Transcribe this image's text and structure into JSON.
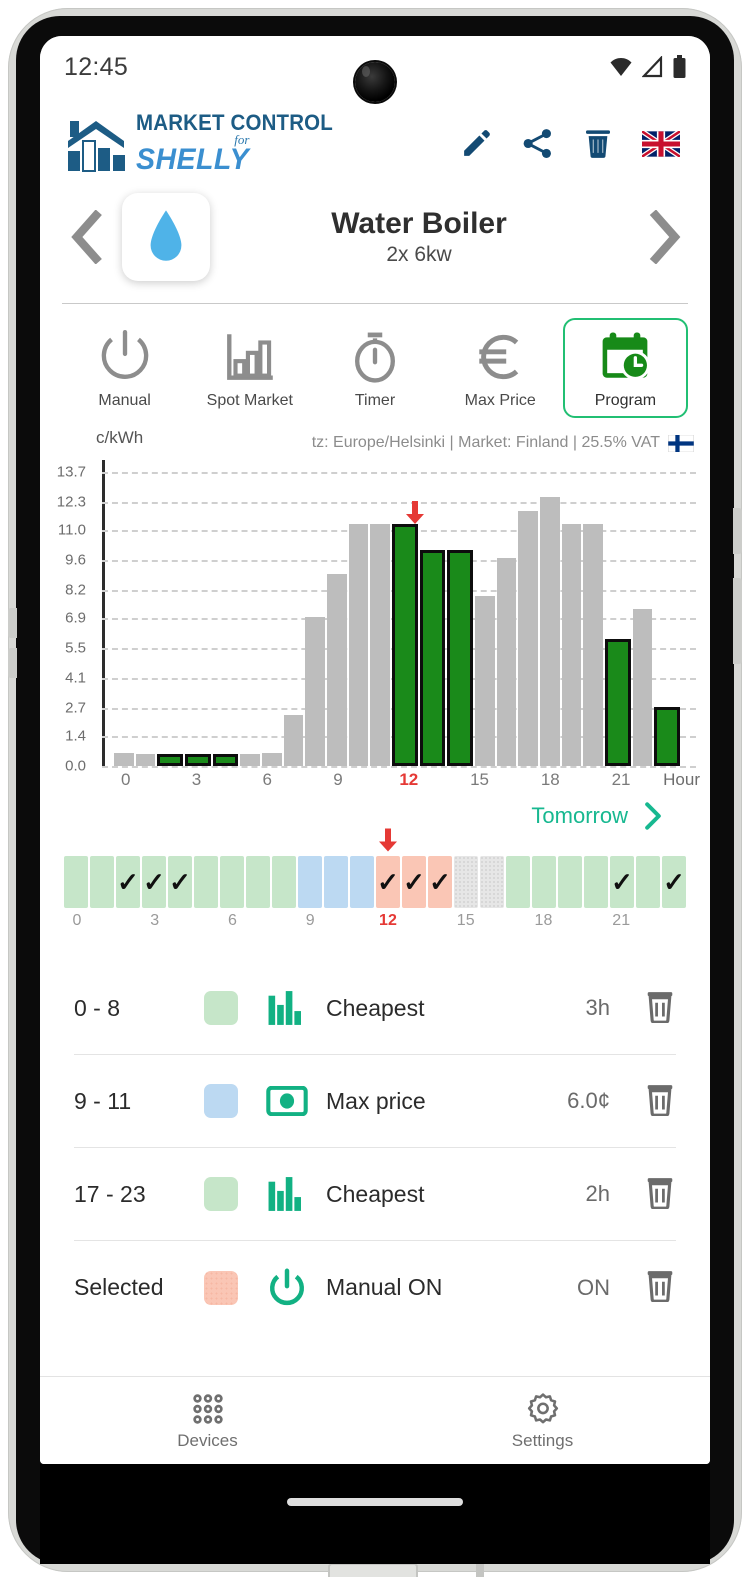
{
  "status": {
    "time": "12:45",
    "icons": [
      "wifi-icon",
      "cellular-icon",
      "battery-icon"
    ]
  },
  "app_bar": {
    "logo": {
      "line1": "MARKET CONTROL",
      "line2": "for",
      "line3": "SHELLY"
    },
    "actions": [
      {
        "name": "edit-icon",
        "label": "Edit"
      },
      {
        "name": "share-icon",
        "label": "Share"
      },
      {
        "name": "delete-icon",
        "label": "Delete"
      },
      {
        "name": "language-flag-icon",
        "label": "English (UK)"
      }
    ]
  },
  "device": {
    "prev_label": "Previous device",
    "next_label": "Next device",
    "icon": "water-drop-icon",
    "name": "Water Boiler",
    "subtitle": "2x 6kw"
  },
  "modes": [
    {
      "id": "manual",
      "label": "Manual",
      "icon": "power-icon",
      "active": false
    },
    {
      "id": "spotmarket",
      "label": "Spot Market",
      "icon": "bar-chart-icon",
      "active": false
    },
    {
      "id": "timer",
      "label": "Timer",
      "icon": "stopwatch-icon",
      "active": false
    },
    {
      "id": "maxprice",
      "label": "Max Price",
      "icon": "euro-icon",
      "active": false
    },
    {
      "id": "program",
      "label": "Program",
      "icon": "calendar-clock-icon",
      "active": true
    }
  ],
  "chart_meta": {
    "unit": "c/kWh",
    "info": "tz: Europe/Helsinki | Market: Finland | 25.5% VAT",
    "flag": "finland-flag-icon",
    "hour_axis_label": "Hour",
    "tomorrow_label": "Tomorrow",
    "tomorrow_icon": "chevron-right-icon"
  },
  "chart_data": {
    "type": "bar",
    "title": "",
    "xlabel": "Hour",
    "ylabel": "c/kWh",
    "ylim": [
      0.0,
      13.7
    ],
    "grid": true,
    "yticks": [
      "0.0",
      "1.4",
      "2.7",
      "4.1",
      "5.5",
      "6.9",
      "8.2",
      "9.6",
      "11.0",
      "12.3",
      "13.7"
    ],
    "ytick_values": [
      0.0,
      1.4,
      2.7,
      4.1,
      5.5,
      6.9,
      8.2,
      9.6,
      11.0,
      12.3,
      13.7
    ],
    "xticks": [
      "0",
      "3",
      "6",
      "9",
      "12",
      "15",
      "18",
      "21"
    ],
    "xtick_values": [
      0,
      3,
      6,
      9,
      12,
      15,
      18,
      21
    ],
    "current_hour": 12,
    "categories": [
      0,
      1,
      2,
      3,
      4,
      5,
      6,
      7,
      8,
      9,
      10,
      11,
      12,
      13,
      14,
      15,
      16,
      17,
      18,
      19,
      20,
      21,
      22,
      23
    ],
    "values": [
      0.6,
      0.55,
      0.55,
      0.55,
      0.55,
      0.55,
      0.6,
      2.4,
      6.95,
      8.95,
      11.3,
      11.3,
      11.3,
      10.05,
      10.05,
      7.9,
      9.7,
      11.9,
      12.55,
      11.3,
      11.3,
      5.9,
      7.3,
      2.75
    ],
    "selected": [
      false,
      false,
      true,
      true,
      true,
      false,
      false,
      false,
      false,
      false,
      false,
      false,
      true,
      true,
      true,
      false,
      false,
      false,
      false,
      false,
      false,
      true,
      false,
      true
    ],
    "bar_color": "#bdbdbd",
    "selected_color": "#1a8a1a",
    "selected_outline": "#0d0d0d",
    "now_marker_hour": 12,
    "now_marker_color": "#e53935"
  },
  "hour_strip": {
    "labels": [
      "0",
      "3",
      "6",
      "9",
      "12",
      "15",
      "18",
      "21"
    ],
    "label_values": [
      0,
      3,
      6,
      9,
      12,
      15,
      18,
      21
    ],
    "current_hour": 12,
    "cells": [
      {
        "hour": 0,
        "color": "green",
        "checked": false
      },
      {
        "hour": 1,
        "color": "green",
        "checked": false
      },
      {
        "hour": 2,
        "color": "green",
        "checked": true
      },
      {
        "hour": 3,
        "color": "green",
        "checked": true
      },
      {
        "hour": 4,
        "color": "green",
        "checked": true
      },
      {
        "hour": 5,
        "color": "green",
        "checked": false
      },
      {
        "hour": 6,
        "color": "green",
        "checked": false
      },
      {
        "hour": 7,
        "color": "green",
        "checked": false
      },
      {
        "hour": 8,
        "color": "green",
        "checked": false
      },
      {
        "hour": 9,
        "color": "blue",
        "checked": false
      },
      {
        "hour": 10,
        "color": "blue",
        "checked": false
      },
      {
        "hour": 11,
        "color": "blue",
        "checked": false
      },
      {
        "hour": 12,
        "color": "salmon",
        "checked": true
      },
      {
        "hour": 13,
        "color": "salmon",
        "checked": true
      },
      {
        "hour": 14,
        "color": "salmon",
        "checked": true
      },
      {
        "hour": 15,
        "color": "gray",
        "checked": false
      },
      {
        "hour": 16,
        "color": "gray",
        "checked": false
      },
      {
        "hour": 17,
        "color": "green",
        "checked": false
      },
      {
        "hour": 18,
        "color": "green",
        "checked": false
      },
      {
        "hour": 19,
        "color": "green",
        "checked": false
      },
      {
        "hour": 20,
        "color": "green",
        "checked": false
      },
      {
        "hour": 21,
        "color": "green",
        "checked": true
      },
      {
        "hour": 22,
        "color": "green",
        "checked": false
      },
      {
        "hour": 23,
        "color": "green",
        "checked": true
      }
    ],
    "check_glyph": "✓"
  },
  "programs": [
    {
      "range": "0 - 8",
      "swatch": "green",
      "icon": "bar-chart-icon",
      "name": "Cheapest",
      "value": "3h",
      "delete": "delete-icon"
    },
    {
      "range": "9 - 11",
      "swatch": "blue",
      "icon": "money-icon",
      "name": "Max price",
      "value": "6.0¢",
      "delete": "delete-icon"
    },
    {
      "range": "17 - 23",
      "swatch": "green",
      "icon": "bar-chart-icon",
      "name": "Cheapest",
      "value": "2h",
      "delete": "delete-icon"
    },
    {
      "range": "Selected",
      "swatch": "salmon",
      "icon": "power-icon",
      "name": "Manual ON",
      "value": "ON",
      "delete": "delete-icon"
    }
  ],
  "bottom_nav": [
    {
      "id": "devices",
      "label": "Devices",
      "icon": "grid-dots-icon"
    },
    {
      "id": "settings",
      "label": "Settings",
      "icon": "gear-icon"
    }
  ],
  "colors": {
    "brand_dark": "#1d5c85",
    "brand_light": "#3b8fd0",
    "accent_green": "#21bf73",
    "teal": "#17b890",
    "now_red": "#e53935",
    "bar_gray": "#bdbdbd",
    "bar_green": "#1a8a1a"
  }
}
